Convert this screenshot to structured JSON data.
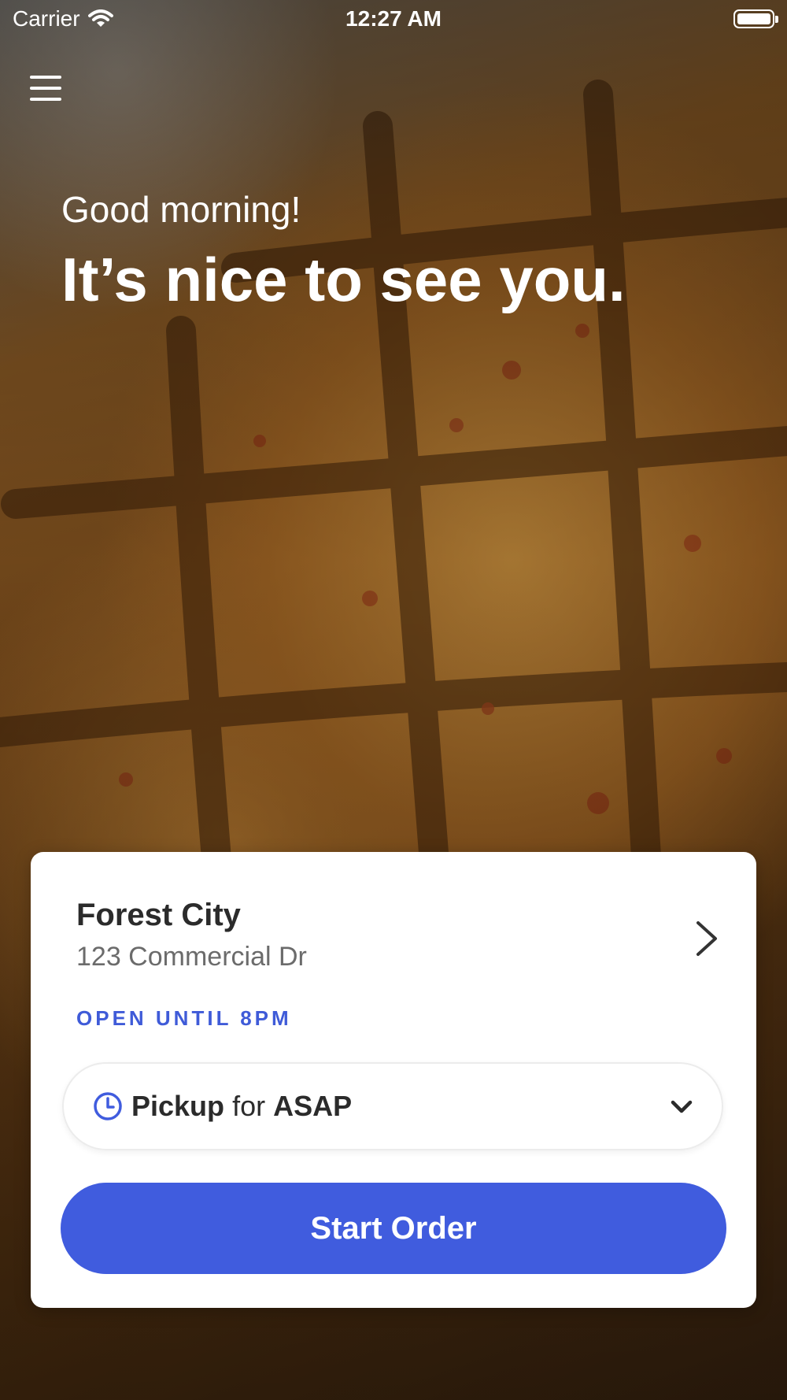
{
  "status_bar": {
    "carrier": "Carrier",
    "time": "12:27 AM"
  },
  "greeting": {
    "subtitle": "Good morning!",
    "headline": "It’s nice to see you."
  },
  "location": {
    "name": "Forest City",
    "address": "123 Commercial Dr",
    "hours": "OPEN UNTIL 8PM"
  },
  "fulfillment": {
    "mode": "Pickup",
    "connector": "for",
    "time": "ASAP"
  },
  "actions": {
    "start_order_label": "Start Order"
  },
  "colors": {
    "accent": "#405cde",
    "hours_text": "#3f5bd8"
  },
  "icons": [
    "wifi-icon",
    "battery-icon",
    "hamburger-menu-icon",
    "chevron-right-icon",
    "clock-icon",
    "chevron-down-icon"
  ]
}
